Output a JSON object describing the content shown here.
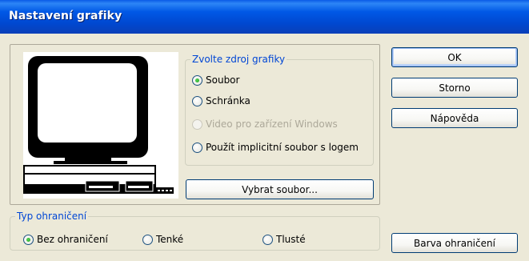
{
  "window": {
    "title": "Nastavení grafiky"
  },
  "source_group": {
    "legend": "Zvolte zdroj grafiky",
    "options": [
      {
        "label": "Soubor",
        "checked": true,
        "disabled": false
      },
      {
        "label": "Schránka",
        "checked": false,
        "disabled": false
      },
      {
        "label": "Video pro zařízení Windows",
        "checked": false,
        "disabled": true
      },
      {
        "label": "Použít implicitní soubor s logem",
        "checked": false,
        "disabled": false
      }
    ]
  },
  "select_file_button": {
    "label": "Vybrat soubor..."
  },
  "border_group": {
    "legend": "Typ ohraničení",
    "options": [
      {
        "label": "Bez ohraničení",
        "checked": true
      },
      {
        "label": "Tenké",
        "checked": false
      },
      {
        "label": "Tlusté",
        "checked": false
      }
    ]
  },
  "buttons": {
    "ok": "OK",
    "cancel": "Storno",
    "help": "Nápověda",
    "border_color": "Barva ohraničení"
  },
  "colors": {
    "title_bar": "#0054e3",
    "face": "#ece9d8",
    "legend_text": "#0046d5",
    "disabled_text": "#aca899"
  },
  "icons": {
    "preview": "computer-monitor-icon"
  }
}
